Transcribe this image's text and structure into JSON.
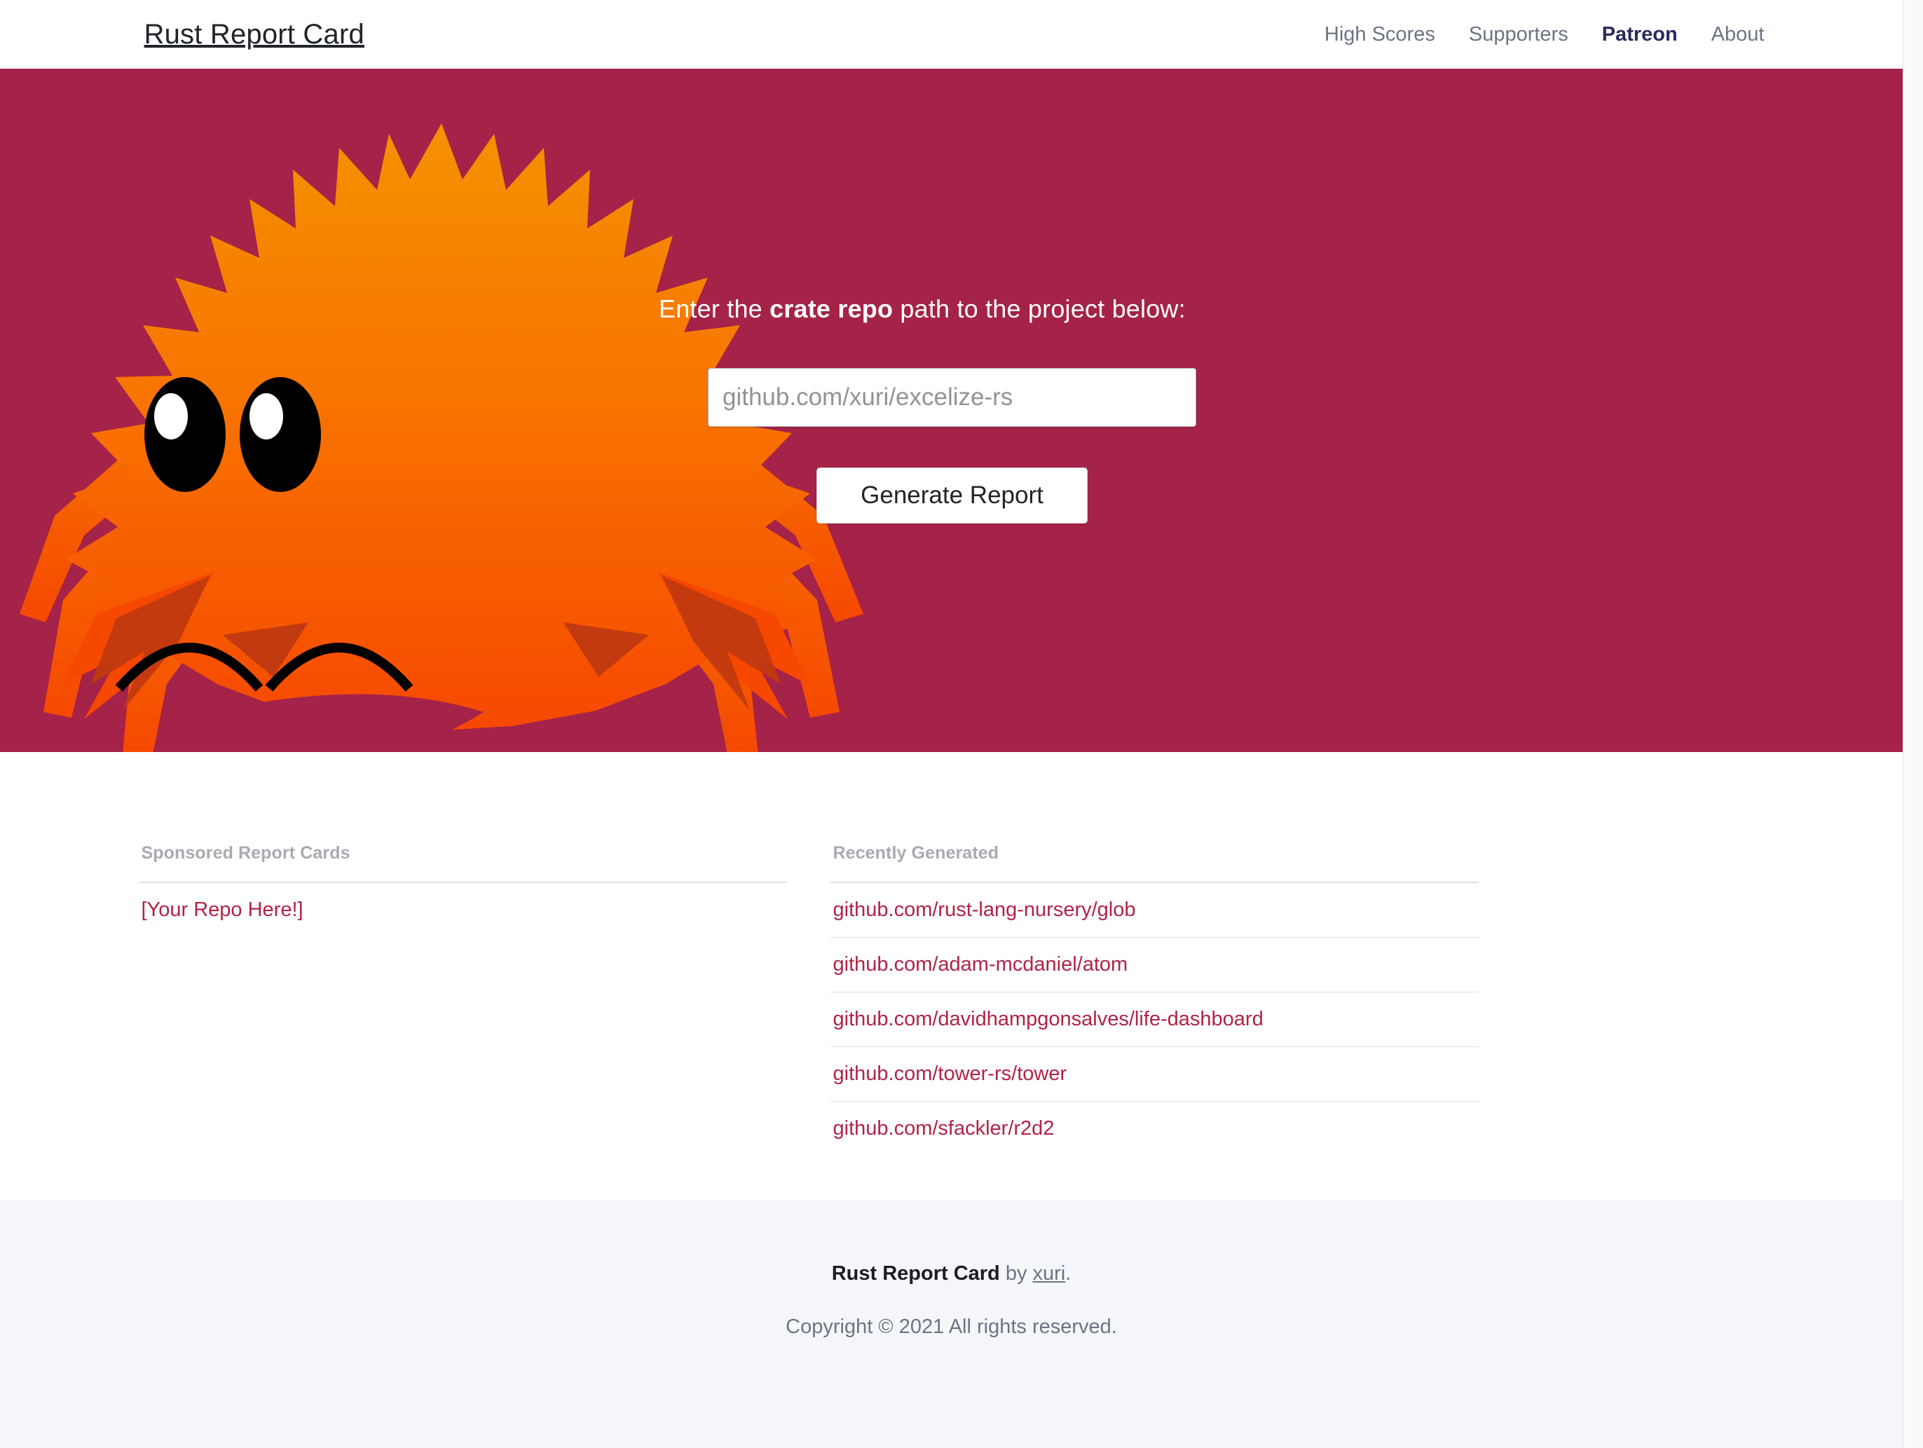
{
  "nav": {
    "brand": "Rust Report Card",
    "links": [
      {
        "label": "High Scores",
        "active": false
      },
      {
        "label": "Supporters",
        "active": false
      },
      {
        "label": "Patreon",
        "active": true
      },
      {
        "label": "About",
        "active": false
      }
    ]
  },
  "hero": {
    "prompt_prefix": "Enter the ",
    "prompt_strong": "crate repo",
    "prompt_suffix": " path to the project below:",
    "input_placeholder": "github.com/xuri/excelize-rs",
    "input_value": "",
    "generate_label": "Generate Report",
    "bg_color": "#a52248",
    "mascot": "ferris-crab-icon"
  },
  "sponsored": {
    "title": "Sponsored Report Cards",
    "items": [
      {
        "label": "[Your Repo Here!]"
      }
    ]
  },
  "recent": {
    "title": "Recently Generated",
    "items": [
      {
        "label": "github.com/rust-lang-nursery/glob"
      },
      {
        "label": "github.com/adam-mcdaniel/atom"
      },
      {
        "label": "github.com/davidhampgonsalves/life-dashboard"
      },
      {
        "label": "github.com/tower-rs/tower"
      },
      {
        "label": "github.com/sfackler/r2d2"
      }
    ]
  },
  "footer": {
    "brand": "Rust Report Card",
    "by": " by ",
    "author": "xuri",
    "period": ".",
    "copyright": "Copyright © 2021 All rights reserved."
  },
  "colors": {
    "hero_bg": "#a52248",
    "link": "#b22247",
    "accent_nav_active": "#2b2a5e",
    "footer_bg": "#f4f6fa",
    "crab_top": "#f59100",
    "crab_bottom": "#f64800",
    "crab_shadow": "#c13a10"
  }
}
